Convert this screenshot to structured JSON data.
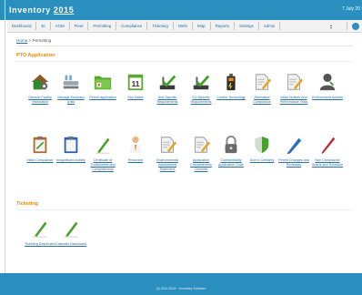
{
  "app": {
    "title": "Inventory",
    "year": "2015",
    "date": "7 July 20"
  },
  "nav": {
    "items": [
      "Dashboard",
      "EI",
      "AOM",
      "Fleet",
      "Permitting",
      "Compliance",
      "Ticketing",
      "NWS",
      "Map",
      "Reports",
      "Settings",
      "Admin"
    ]
  },
  "breadcrumb": {
    "home": "Home",
    "separator": ">",
    "current": "Permitting"
  },
  "sections": {
    "pto": {
      "title": "PTO Application",
      "tiles": [
        {
          "label": "General Facility Information",
          "icon": "house-gear-icon"
        },
        {
          "label": "Manage Emission Units",
          "icon": "equipment-icon"
        },
        {
          "label": "Permit Application",
          "icon": "green-folder-icon"
        },
        {
          "label": "Key Dates",
          "icon": "calendar-icon",
          "day": "11"
        },
        {
          "label": "Unit-Specific Requirements",
          "icon": "green-check-icon"
        },
        {
          "label": "EU-Specific Requirements",
          "icon": "green-check-icon"
        },
        {
          "label": "Control Technology",
          "icon": "battery-icon"
        },
        {
          "label": "Alternative Compliance",
          "icon": "document-pencil-icon"
        },
        {
          "label": "Initial Notices And Performance Tests",
          "icon": "document-pencil-icon"
        },
        {
          "label": "Enforcement Actions",
          "icon": "person-icon"
        },
        {
          "label": "Initial Compliance",
          "icon": "clipboard-icon"
        },
        {
          "label": "Insignificant Activity",
          "icon": "blue-clipboard-icon"
        },
        {
          "label": "Certificate of Truthfulness and Completeness",
          "icon": "green-pencil-icon"
        },
        {
          "label": "Personnel",
          "icon": "businessman-icon"
        },
        {
          "label": "Environmental Assessment Statement",
          "icon": "document-pencil-icon"
        },
        {
          "label": "Application Completeness Checklist",
          "icon": "document-pencil-icon"
        },
        {
          "label": "Confidentiality Application Code",
          "icon": "padlock-icon"
        },
        {
          "label": "Due to Certainty",
          "icon": "green-shield-icon"
        },
        {
          "label": "Permit Changes and Renewals",
          "icon": "blue-pencil-icon"
        },
        {
          "label": "Non Compliance Status and Schedule",
          "icon": "red-pen-icon"
        }
      ]
    },
    "ticketing": {
      "title": "Ticketing",
      "tiles": [
        {
          "label": "Ticketing Dashboard",
          "icon": "green-pencil-icon"
        },
        {
          "label": "Calendar Dashboard",
          "icon": "green-pencil-icon"
        }
      ]
    }
  },
  "footer": {
    "text": "(c) 2011-2015 ~ Inventory Software"
  },
  "colors": {
    "header": "#2a8fbf",
    "section": "#f08a00",
    "link": "#2a6fa8"
  }
}
